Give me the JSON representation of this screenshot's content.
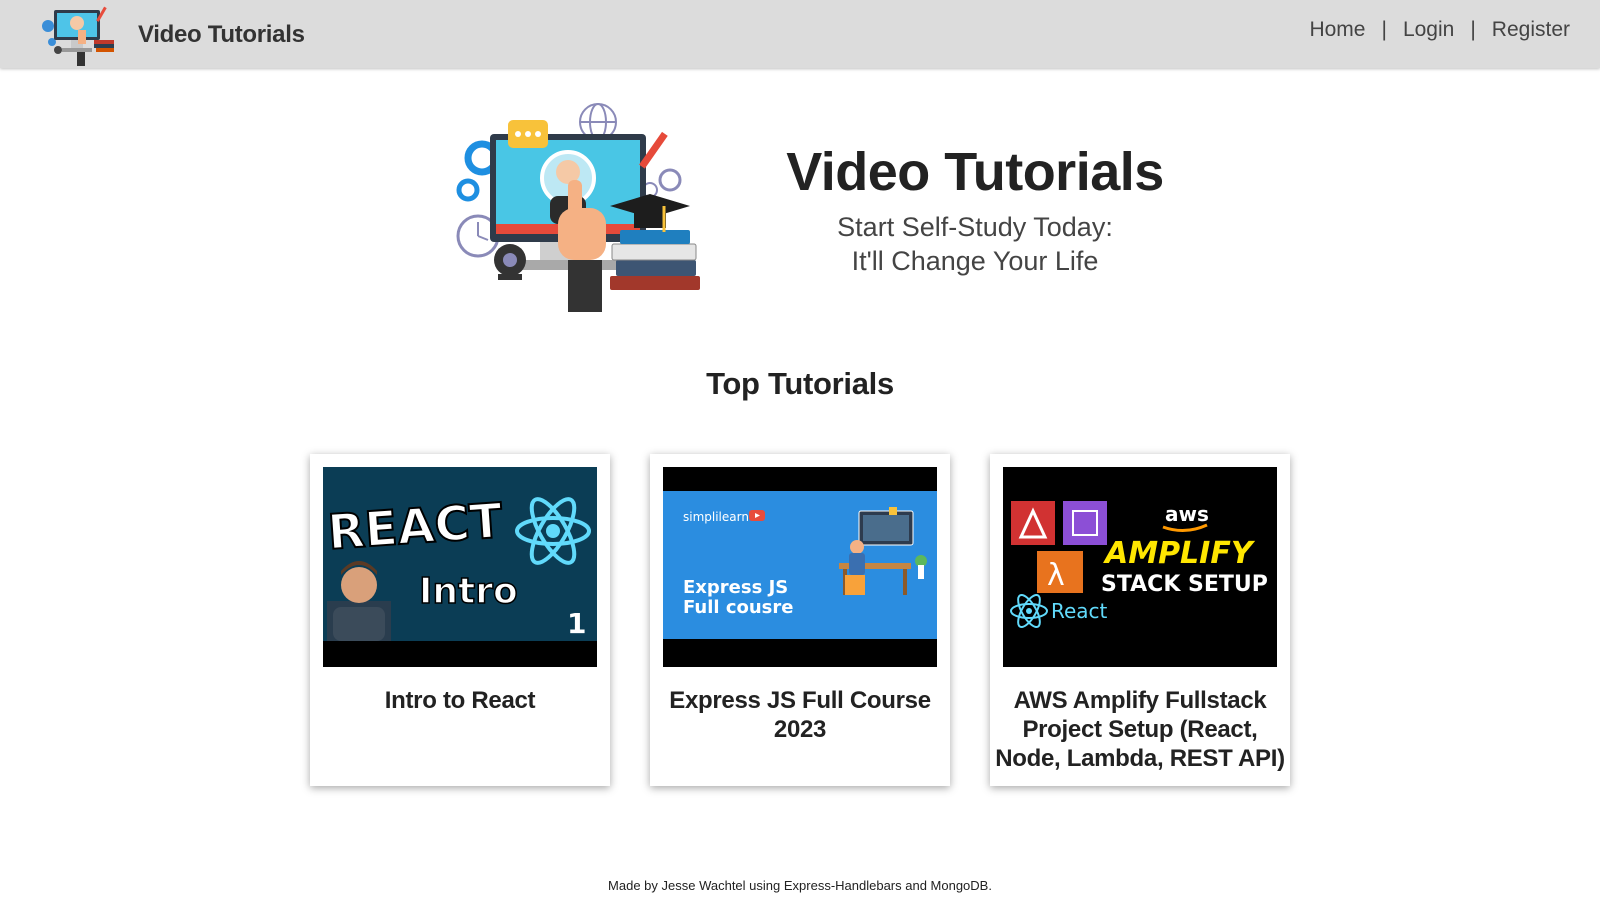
{
  "header": {
    "brand_title": "Video Tutorials",
    "nav": [
      {
        "label": "Home"
      },
      {
        "label": "Login"
      },
      {
        "label": "Register"
      }
    ],
    "separator": "|"
  },
  "hero": {
    "title": "Video Tutorials",
    "subtitle_line1": "Start Self-Study Today:",
    "subtitle_line2": "It'll Change Your Life"
  },
  "section": {
    "heading": "Top Tutorials"
  },
  "cards": [
    {
      "title": "Intro to React",
      "thumb": {
        "line1": "REACT",
        "line2": "Intro",
        "badge": "1"
      }
    },
    {
      "title": "Express JS Full Course 2023",
      "thumb": {
        "brand": "simplilearn",
        "line1": "Express JS",
        "line2": "Full cousre"
      }
    },
    {
      "title": "AWS Amplify Fullstack Project Setup (React, Node, Lambda, REST API)",
      "thumb": {
        "aws": "aws",
        "line1": "AMPLIFY",
        "line2": "STACK SETUP",
        "react": "React"
      }
    }
  ],
  "footer": {
    "text": "Made by Jesse Wachtel using Express-Handlebars and MongoDB."
  },
  "colors": {
    "navbar_bg": "#dcdcdc",
    "react_thumb_bg": "#0b3d55",
    "react_blue": "#61dafb",
    "express_thumb_bg": "#2b8de0",
    "amplify_yellow": "#ffe600"
  }
}
